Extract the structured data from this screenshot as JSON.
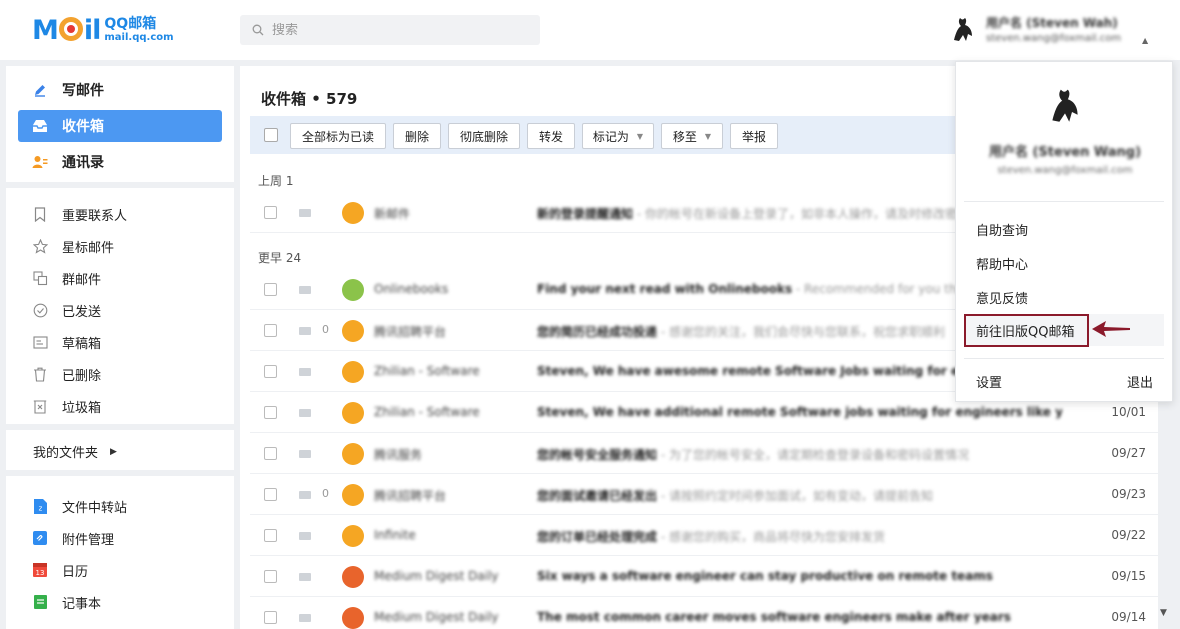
{
  "brand": {
    "logo_word": "M",
    "logo_word_tail": "il",
    "logo_cn": "QQ邮箱",
    "logo_url": "mail.qq.com",
    "accent": "#1e88e5"
  },
  "search": {
    "placeholder": "搜索",
    "icon": "search-icon"
  },
  "user": {
    "name": "用户名 (Steven Wah)",
    "email": "steven.wang@foxmail.com"
  },
  "sidebar": {
    "compose": "写邮件",
    "inbox": "收件箱",
    "contacts": "通讯录",
    "folders": [
      {
        "label": "重要联系人",
        "icon": "bookmark-icon"
      },
      {
        "label": "星标邮件",
        "icon": "star-icon"
      },
      {
        "label": "群邮件",
        "icon": "group-icon"
      },
      {
        "label": "已发送",
        "icon": "sent-check-icon"
      },
      {
        "label": "草稿箱",
        "icon": "draft-icon"
      },
      {
        "label": "已删除",
        "icon": "trash-icon"
      },
      {
        "label": "垃圾箱",
        "icon": "spam-icon"
      }
    ],
    "my_folders": "我的文件夹",
    "tools": [
      {
        "label": "文件中转站",
        "icon": "file-transfer-icon",
        "color": "#2f8cf0"
      },
      {
        "label": "附件管理",
        "icon": "attachment-manager-icon",
        "color": "#2f8cf0"
      },
      {
        "label": "日历",
        "icon": "calendar-icon",
        "color": "#f04a3b"
      },
      {
        "label": "记事本",
        "icon": "notepad-icon",
        "color": "#35b04b"
      }
    ]
  },
  "main": {
    "title": "收件箱 • 579",
    "toolbar": {
      "mark_all_read": "全部标为已读",
      "delete": "删除",
      "perm_delete": "彻底删除",
      "forward": "转发",
      "mark_as": "标记为",
      "move_to": "移至",
      "report": "举报"
    },
    "groups": {
      "last_week": "上周 1",
      "earlier": "更早 24"
    },
    "rows": [
      {
        "sender": "新邮件",
        "subject": "新的登录提醒通知",
        "preview": " - 你的帐号在新设备上登录了，如非本人操作，请及时修改密码",
        "date": "",
        "clip": "",
        "avatar_color": "#f5a623"
      },
      {
        "sender": "Onlinebooks",
        "subject": "Find your next read with Onlinebooks",
        "preview": " - Recommended for you this week",
        "date": "",
        "clip": "",
        "avatar_color": "#8bc34a"
      },
      {
        "sender": "腾讯招聘平台",
        "subject": "您的简历已经成功投递",
        "preview": " - 感谢您的关注，我们会尽快与您联系，祝您求职顺利",
        "date": "",
        "clip": "0",
        "avatar_color": "#f5a623"
      },
      {
        "sender": "Zhilian - Software",
        "subject": "Steven, We have awesome remote Software Jobs waiting for engineers",
        "preview": "",
        "date": "",
        "clip": "",
        "avatar_color": "#f5a623"
      },
      {
        "sender": "Zhilian - Software",
        "subject": "Steven, We have additional remote Software jobs waiting for engineers like you",
        "preview": "",
        "date": "10/01",
        "clip": "",
        "avatar_color": "#f5a623"
      },
      {
        "sender": "腾讯服务",
        "subject": "您的帐号安全服务通知",
        "preview": " - 为了您的帐号安全，请定期检查登录设备和密码设置情况",
        "date": "09/27",
        "clip": "",
        "avatar_color": "#f5a623"
      },
      {
        "sender": "腾讯招聘平台",
        "subject": "您的面试邀请已经发出",
        "preview": " - 请按照约定时间参加面试，如有变动，请提前告知",
        "date": "09/23",
        "clip": "0",
        "avatar_color": "#f5a623"
      },
      {
        "sender": "Infinite",
        "subject": "您的订单已经处理完成",
        "preview": " - 感谢您的购买，商品将尽快为您安排发货",
        "date": "09/22",
        "clip": "",
        "avatar_color": "#f5a623"
      },
      {
        "sender": "Medium Digest Daily",
        "subject": "Six ways a software engineer can stay productive on remote teams",
        "preview": "",
        "date": "09/15",
        "clip": "",
        "avatar_color": "#e8642c"
      },
      {
        "sender": "Medium Digest Daily",
        "subject": "The most common career moves software engineers make after years",
        "preview": "",
        "date": "09/14",
        "clip": "",
        "avatar_color": "#e8642c"
      }
    ]
  },
  "dropdown": {
    "name": "用户名 (Steven Wang)",
    "email": "steven.wang@foxmail.com",
    "items": [
      "自助查询",
      "帮助中心",
      "意见反馈",
      "前往旧版QQ邮箱"
    ],
    "settings": "设置",
    "logout": "退出",
    "highlight_color": "#8b1a2b"
  }
}
